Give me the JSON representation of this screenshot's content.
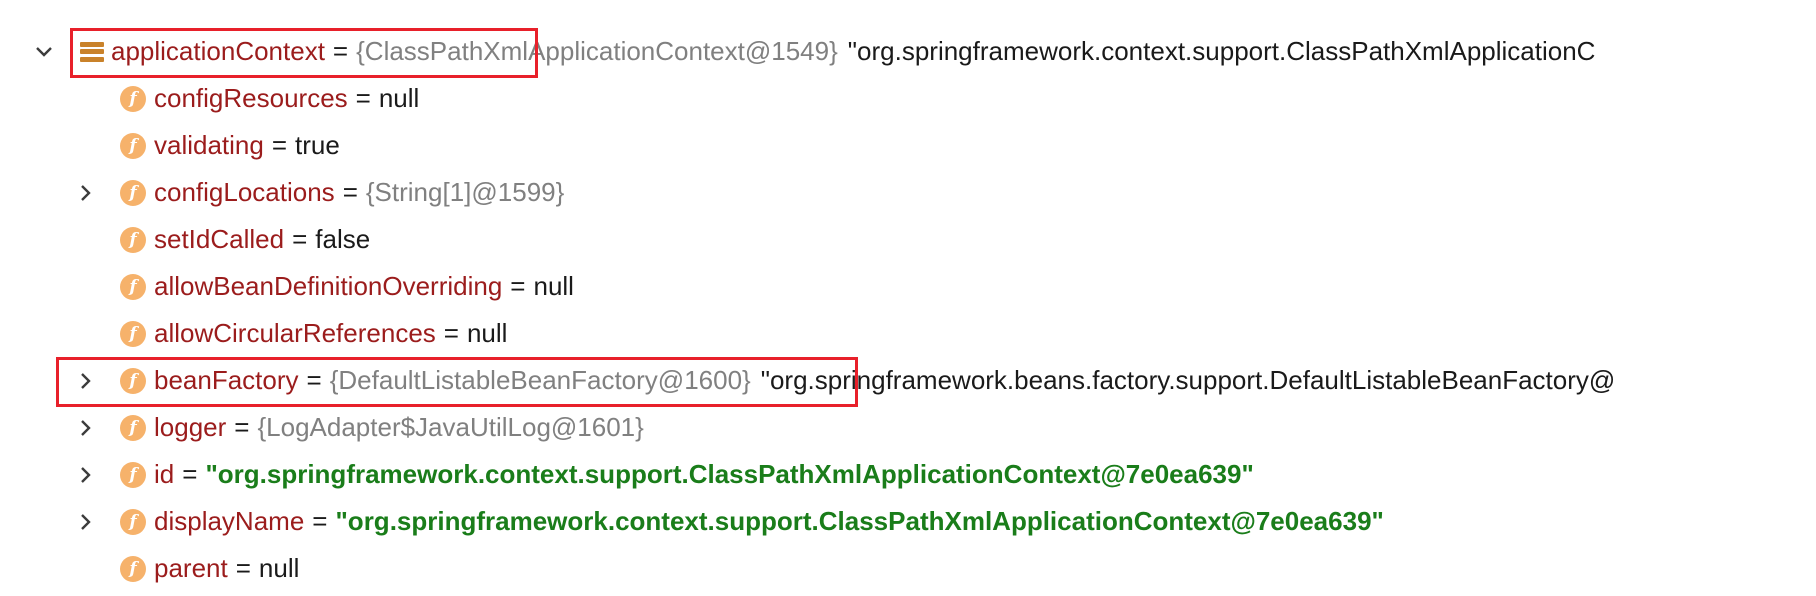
{
  "tree": {
    "root": {
      "name": "applicationContext",
      "eq": "=",
      "ref": "{ClassPathXmlApplicationContext@1549}",
      "desc": "\"org.springframework.context.support.ClassPathXmlApplicationC",
      "expanded": true,
      "icon": "object-icon"
    },
    "fields": [
      {
        "name": "configResources",
        "eq": "=",
        "value": "null",
        "kind": "literal",
        "expandable": false
      },
      {
        "name": "validating",
        "eq": "=",
        "value": "true",
        "kind": "literal",
        "expandable": false
      },
      {
        "name": "configLocations",
        "eq": "=",
        "value": "{String[1]@1599}",
        "kind": "ref",
        "expandable": true
      },
      {
        "name": "setIdCalled",
        "eq": "=",
        "value": "false",
        "kind": "literal",
        "expandable": false
      },
      {
        "name": "allowBeanDefinitionOverriding",
        "eq": "=",
        "value": "null",
        "kind": "literal",
        "expandable": false
      },
      {
        "name": "allowCircularReferences",
        "eq": "=",
        "value": "null",
        "kind": "literal",
        "expandable": false
      },
      {
        "name": "beanFactory",
        "eq": "=",
        "value": "{DefaultListableBeanFactory@1600}",
        "kind": "ref",
        "desc": "\"org.springframework.beans.factory.support.DefaultListableBeanFactory@",
        "expandable": true
      },
      {
        "name": "logger",
        "eq": "=",
        "value": "{LogAdapter$JavaUtilLog@1601}",
        "kind": "ref",
        "expandable": true
      },
      {
        "name": "id",
        "eq": "=",
        "value": "\"org.springframework.context.support.ClassPathXmlApplicationContext@7e0ea639\"",
        "kind": "string",
        "expandable": true
      },
      {
        "name": "displayName",
        "eq": "=",
        "value": "\"org.springframework.context.support.ClassPathXmlApplicationContext@7e0ea639\"",
        "kind": "string",
        "expandable": true
      },
      {
        "name": "parent",
        "eq": "=",
        "value": "null",
        "kind": "literal",
        "expandable": false
      }
    ],
    "field_icon_letter": "f"
  },
  "colors": {
    "field_name": "#9b1c1c",
    "reference": "#808080",
    "string_value": "#1a7d1a",
    "field_icon_bg": "#f6b26b",
    "object_icon": "#c9822a",
    "highlight_box": "#e8202a"
  }
}
